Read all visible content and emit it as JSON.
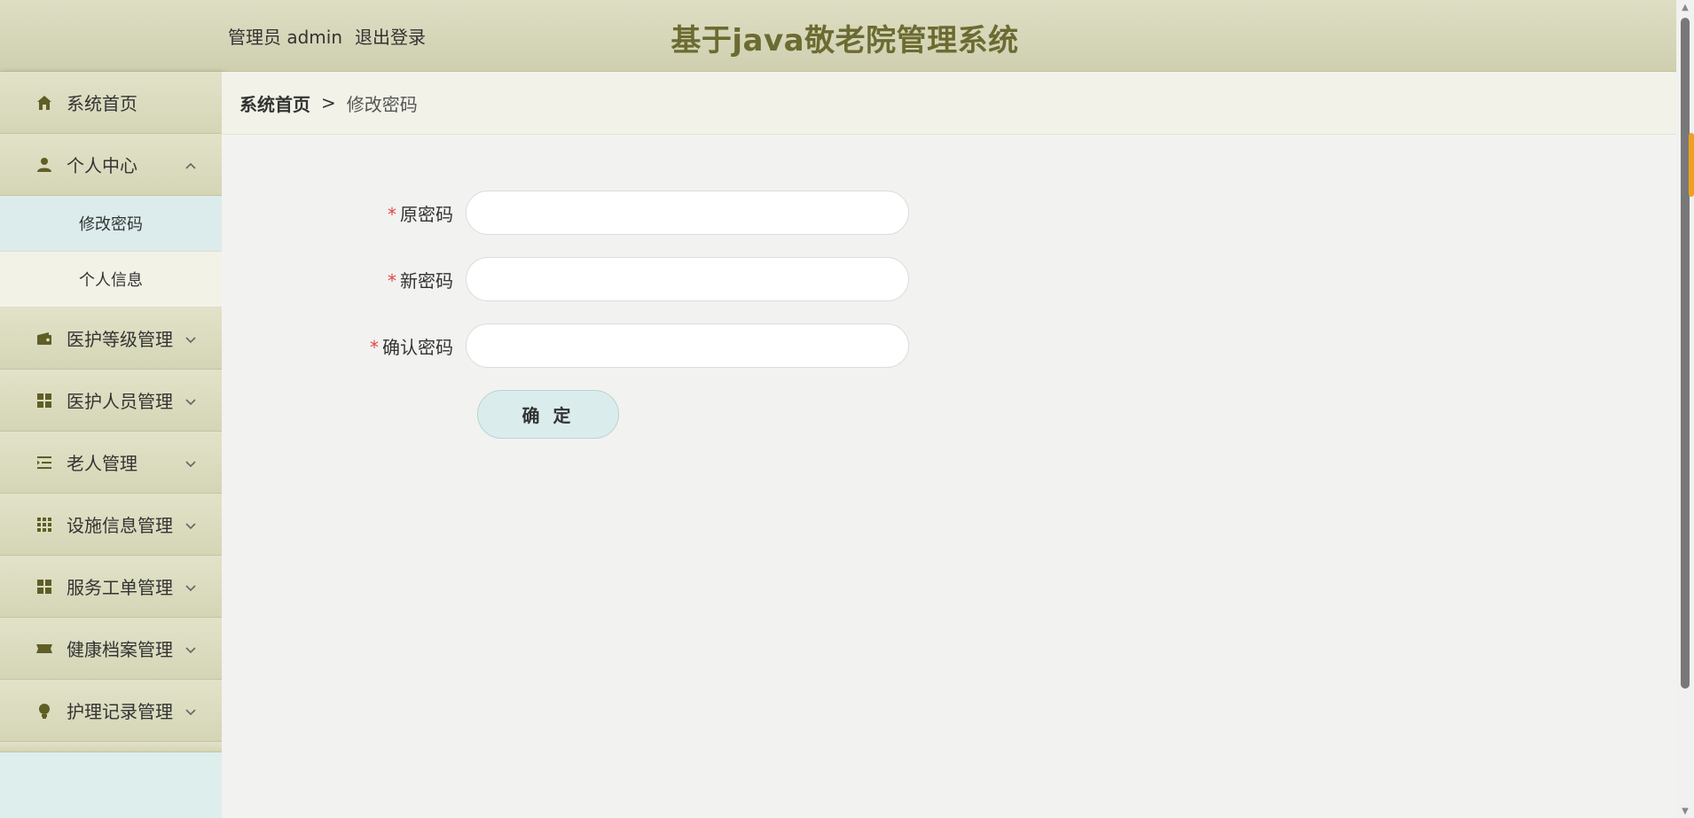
{
  "header": {
    "user_label": "管理员 admin",
    "logout_label": "退出登录",
    "title": "基于java敬老院管理系统"
  },
  "sidebar": {
    "items": [
      {
        "label": "系统首页",
        "icon": "home-icon"
      },
      {
        "label": "个人中心",
        "icon": "user-icon",
        "expanded": true,
        "children": [
          {
            "label": "修改密码",
            "active": true
          },
          {
            "label": "个人信息",
            "active": false
          }
        ]
      },
      {
        "label": "医护等级管理",
        "icon": "wallet-icon"
      },
      {
        "label": "医护人员管理",
        "icon": "grid-icon"
      },
      {
        "label": "老人管理",
        "icon": "list-indent-icon"
      },
      {
        "label": "设施信息管理",
        "icon": "apps-icon"
      },
      {
        "label": "服务工单管理",
        "icon": "grid-icon"
      },
      {
        "label": "健康档案管理",
        "icon": "ticket-icon"
      },
      {
        "label": "护理记录管理",
        "icon": "bulb-icon"
      }
    ]
  },
  "breadcrumb": {
    "home": "系统首页",
    "separator": ">",
    "current": "修改密码"
  },
  "form": {
    "old_password_label": "原密码",
    "new_password_label": "新密码",
    "confirm_password_label": "确认密码",
    "required_mark": "*",
    "old_password_value": "",
    "new_password_value": "",
    "confirm_password_value": "",
    "submit_label": "确 定"
  },
  "colors": {
    "title": "#6b6b32",
    "header_bg": "#d5d5b8",
    "active_submenu": "#dcecec",
    "required": "#e04646"
  }
}
